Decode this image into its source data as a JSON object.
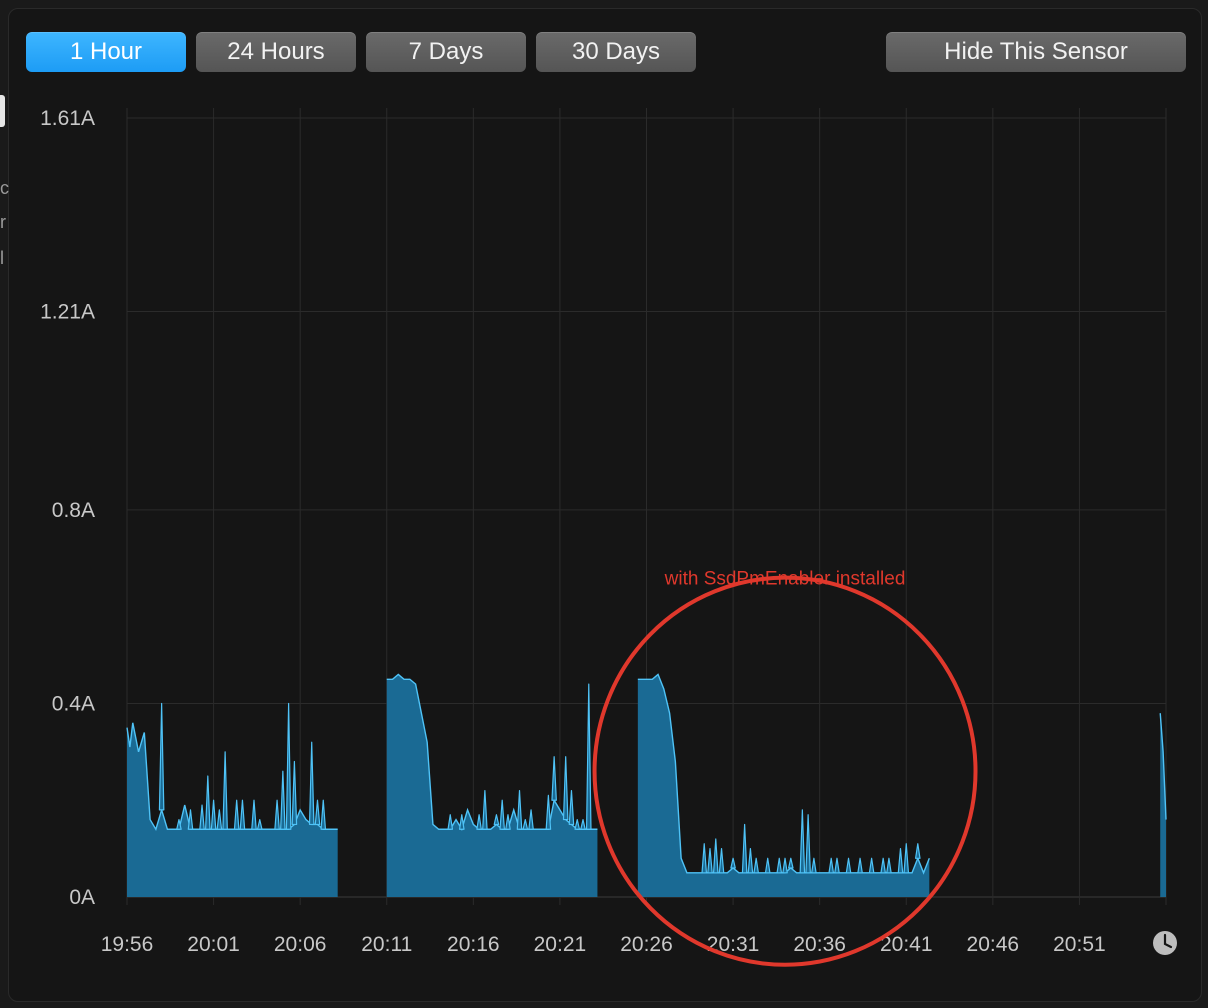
{
  "toolbar": {
    "ranges": [
      {
        "label": "1 Hour",
        "active": true
      },
      {
        "label": "24 Hours",
        "active": false
      },
      {
        "label": "7 Days",
        "active": false
      },
      {
        "label": "30 Days",
        "active": false
      }
    ],
    "hide_label": "Hide This Sensor"
  },
  "colors": {
    "accent": "#1ea0f7",
    "series_line": "#4fc3f7",
    "series_fill": "#1a6a94",
    "annotation": "#e0382c"
  },
  "icons": {
    "time": "clock-icon"
  },
  "chart_data": {
    "type": "area",
    "title": "",
    "xlabel": "",
    "ylabel": "",
    "y_ticks": [
      "1.61A",
      "1.21A",
      "0.8A",
      "0.4A",
      "0A"
    ],
    "y_tick_values": [
      1.61,
      1.21,
      0.8,
      0.4,
      0
    ],
    "ylim": [
      0,
      1.61
    ],
    "x_ticks": [
      "19:56",
      "20:01",
      "20:06",
      "20:11",
      "20:16",
      "20:21",
      "20:26",
      "20:31",
      "20:36",
      "20:41",
      "20:46",
      "20:51"
    ],
    "x_tick_values": [
      "19:56",
      "20:01",
      "20:06",
      "20:11",
      "20:16",
      "20:21",
      "20:26",
      "20:31",
      "20:36",
      "20:41",
      "20:46",
      "20:51"
    ],
    "xlim": [
      "19:56",
      "20:56"
    ],
    "grid": true,
    "series": [
      {
        "segments": [
          [
            [
              "19:56:00",
              0.35
            ],
            [
              "19:56:10",
              0.31
            ],
            [
              "19:56:20",
              0.36
            ],
            [
              "19:56:40",
              0.3
            ],
            [
              "19:57:00",
              0.34
            ],
            [
              "19:57:20",
              0.16
            ],
            [
              "19:57:40",
              0.14
            ],
            [
              "19:58:00",
              0.18
            ],
            [
              "19:58:20",
              0.14
            ],
            [
              "19:58:40",
              0.14
            ],
            [
              "19:59:00",
              0.14
            ],
            [
              "19:59:20",
              0.19
            ],
            [
              "19:59:40",
              0.14
            ],
            [
              "20:00:00",
              0.14
            ],
            [
              "20:00:20",
              0.14
            ],
            [
              "20:00:40",
              0.14
            ],
            [
              "20:01:00",
              0.14
            ],
            [
              "20:01:20",
              0.14
            ],
            [
              "20:01:40",
              0.14
            ],
            [
              "20:02:00",
              0.14
            ],
            [
              "20:02:20",
              0.14
            ],
            [
              "20:02:40",
              0.14
            ],
            [
              "20:03:00",
              0.14
            ],
            [
              "20:03:20",
              0.14
            ],
            [
              "20:03:40",
              0.14
            ],
            [
              "20:04:00",
              0.14
            ],
            [
              "20:04:20",
              0.14
            ],
            [
              "20:04:40",
              0.14
            ],
            [
              "20:05:00",
              0.14
            ],
            [
              "20:05:20",
              0.14
            ],
            [
              "20:05:40",
              0.15
            ],
            [
              "20:06:00",
              0.18
            ],
            [
              "20:06:20",
              0.16
            ],
            [
              "20:06:40",
              0.15
            ],
            [
              "20:07:00",
              0.15
            ],
            [
              "20:07:20",
              0.14
            ],
            [
              "20:07:40",
              0.14
            ],
            [
              "20:08:00",
              0.14
            ],
            [
              "20:08:10",
              0.14
            ]
          ],
          [
            [
              "20:11:00",
              0.45
            ],
            [
              "20:11:20",
              0.45
            ],
            [
              "20:11:40",
              0.46
            ],
            [
              "20:12:00",
              0.45
            ],
            [
              "20:12:20",
              0.45
            ],
            [
              "20:12:40",
              0.44
            ],
            [
              "20:13:00",
              0.38
            ],
            [
              "20:13:20",
              0.32
            ],
            [
              "20:13:40",
              0.15
            ],
            [
              "20:14:00",
              0.14
            ],
            [
              "20:14:20",
              0.14
            ],
            [
              "20:14:40",
              0.14
            ],
            [
              "20:15:00",
              0.16
            ],
            [
              "20:15:20",
              0.14
            ],
            [
              "20:15:40",
              0.18
            ],
            [
              "20:16:00",
              0.15
            ],
            [
              "20:16:20",
              0.14
            ],
            [
              "20:16:40",
              0.14
            ],
            [
              "20:17:00",
              0.14
            ],
            [
              "20:17:20",
              0.15
            ],
            [
              "20:17:40",
              0.14
            ],
            [
              "20:18:00",
              0.14
            ],
            [
              "20:18:20",
              0.18
            ],
            [
              "20:18:40",
              0.14
            ],
            [
              "20:19:00",
              0.14
            ],
            [
              "20:19:20",
              0.14
            ],
            [
              "20:19:40",
              0.14
            ],
            [
              "20:20:00",
              0.14
            ],
            [
              "20:20:20",
              0.14
            ],
            [
              "20:20:40",
              0.2
            ],
            [
              "20:21:00",
              0.18
            ],
            [
              "20:21:20",
              0.16
            ],
            [
              "20:21:40",
              0.15
            ],
            [
              "20:22:00",
              0.14
            ],
            [
              "20:22:20",
              0.14
            ],
            [
              "20:22:40",
              0.14
            ],
            [
              "20:23:00",
              0.14
            ],
            [
              "20:23:10",
              0.14
            ]
          ],
          [
            [
              "20:25:30",
              0.45
            ],
            [
              "20:25:40",
              0.45
            ],
            [
              "20:26:00",
              0.45
            ],
            [
              "20:26:20",
              0.45
            ],
            [
              "20:26:40",
              0.46
            ],
            [
              "20:27:00",
              0.43
            ],
            [
              "20:27:20",
              0.38
            ],
            [
              "20:27:40",
              0.28
            ],
            [
              "20:28:00",
              0.08
            ],
            [
              "20:28:20",
              0.05
            ],
            [
              "20:28:40",
              0.05
            ],
            [
              "20:29:00",
              0.05
            ],
            [
              "20:29:20",
              0.05
            ],
            [
              "20:29:40",
              0.05
            ],
            [
              "20:30:00",
              0.05
            ],
            [
              "20:30:20",
              0.05
            ],
            [
              "20:30:40",
              0.05
            ],
            [
              "20:31:00",
              0.06
            ],
            [
              "20:31:20",
              0.05
            ],
            [
              "20:31:40",
              0.05
            ],
            [
              "20:32:00",
              0.05
            ],
            [
              "20:32:20",
              0.05
            ],
            [
              "20:32:40",
              0.05
            ],
            [
              "20:33:00",
              0.05
            ],
            [
              "20:33:20",
              0.05
            ],
            [
              "20:33:40",
              0.05
            ],
            [
              "20:34:00",
              0.05
            ],
            [
              "20:34:20",
              0.06
            ],
            [
              "20:34:40",
              0.05
            ],
            [
              "20:35:00",
              0.05
            ],
            [
              "20:35:20",
              0.05
            ],
            [
              "20:35:40",
              0.05
            ],
            [
              "20:36:00",
              0.05
            ],
            [
              "20:36:20",
              0.05
            ],
            [
              "20:36:40",
              0.05
            ],
            [
              "20:37:00",
              0.05
            ],
            [
              "20:37:20",
              0.05
            ],
            [
              "20:37:40",
              0.05
            ],
            [
              "20:38:00",
              0.05
            ],
            [
              "20:38:20",
              0.05
            ],
            [
              "20:38:40",
              0.05
            ],
            [
              "20:39:00",
              0.05
            ],
            [
              "20:39:20",
              0.05
            ],
            [
              "20:39:40",
              0.05
            ],
            [
              "20:40:00",
              0.05
            ],
            [
              "20:40:20",
              0.05
            ],
            [
              "20:40:40",
              0.05
            ],
            [
              "20:41:00",
              0.05
            ],
            [
              "20:41:20",
              0.05
            ],
            [
              "20:41:40",
              0.08
            ],
            [
              "20:42:00",
              0.05
            ],
            [
              "20:42:20",
              0.08
            ]
          ],
          [
            [
              "20:55:40",
              0.38
            ],
            [
              "20:55:50",
              0.3
            ],
            [
              "20:56:00",
              0.16
            ]
          ]
        ],
        "spikes": [
          [
            "19:58:00",
            0.4
          ],
          [
            "19:59:00",
            0.16
          ],
          [
            "19:59:40",
            0.18
          ],
          [
            "20:00:20",
            0.19
          ],
          [
            "20:00:40",
            0.25
          ],
          [
            "20:01:00",
            0.2
          ],
          [
            "20:01:20",
            0.18
          ],
          [
            "20:01:40",
            0.3
          ],
          [
            "20:02:20",
            0.2
          ],
          [
            "20:02:40",
            0.2
          ],
          [
            "20:03:20",
            0.2
          ],
          [
            "20:03:40",
            0.16
          ],
          [
            "20:04:40",
            0.2
          ],
          [
            "20:05:00",
            0.26
          ],
          [
            "20:05:20",
            0.4
          ],
          [
            "20:05:40",
            0.28
          ],
          [
            "20:06:40",
            0.32
          ],
          [
            "20:07:00",
            0.2
          ],
          [
            "20:07:20",
            0.2
          ],
          [
            "20:14:40",
            0.17
          ],
          [
            "20:15:20",
            0.17
          ],
          [
            "20:16:20",
            0.17
          ],
          [
            "20:16:40",
            0.22
          ],
          [
            "20:17:20",
            0.17
          ],
          [
            "20:17:40",
            0.2
          ],
          [
            "20:18:00",
            0.17
          ],
          [
            "20:18:40",
            0.22
          ],
          [
            "20:19:00",
            0.16
          ],
          [
            "20:19:20",
            0.18
          ],
          [
            "20:20:20",
            0.21
          ],
          [
            "20:20:40",
            0.29
          ],
          [
            "20:21:20",
            0.29
          ],
          [
            "20:21:40",
            0.22
          ],
          [
            "20:22:00",
            0.16
          ],
          [
            "20:22:20",
            0.16
          ],
          [
            "20:22:40",
            0.44
          ],
          [
            "20:29:20",
            0.11
          ],
          [
            "20:29:40",
            0.1
          ],
          [
            "20:30:00",
            0.12
          ],
          [
            "20:30:20",
            0.1
          ],
          [
            "20:31:00",
            0.08
          ],
          [
            "20:31:40",
            0.15
          ],
          [
            "20:32:00",
            0.1
          ],
          [
            "20:32:20",
            0.08
          ],
          [
            "20:33:00",
            0.08
          ],
          [
            "20:33:40",
            0.08
          ],
          [
            "20:34:00",
            0.08
          ],
          [
            "20:34:20",
            0.08
          ],
          [
            "20:35:00",
            0.18
          ],
          [
            "20:35:20",
            0.17
          ],
          [
            "20:35:40",
            0.08
          ],
          [
            "20:36:40",
            0.08
          ],
          [
            "20:37:00",
            0.08
          ],
          [
            "20:37:40",
            0.08
          ],
          [
            "20:38:20",
            0.08
          ],
          [
            "20:39:00",
            0.08
          ],
          [
            "20:39:40",
            0.08
          ],
          [
            "20:40:00",
            0.08
          ],
          [
            "20:40:40",
            0.1
          ],
          [
            "20:41:00",
            0.11
          ],
          [
            "20:41:40",
            0.11
          ]
        ]
      }
    ],
    "annotations": [
      {
        "text": "with SsdPmEnabler installed",
        "x": "20:34",
        "y": 0.66,
        "shape": "ellipse",
        "center": [
          "20:34",
          0.26
        ],
        "rx_minutes": 11,
        "ry": 0.4
      }
    ]
  }
}
